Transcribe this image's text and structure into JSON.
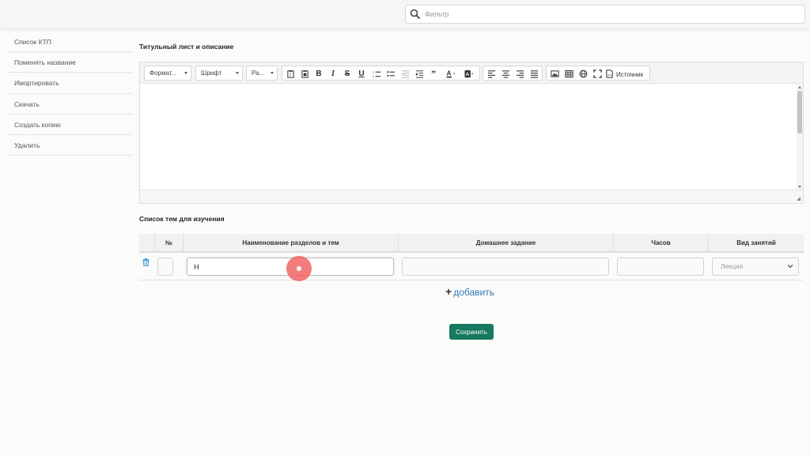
{
  "search": {
    "placeholder": "Фильтр"
  },
  "sidebar": {
    "items": [
      {
        "label": "Список КТП"
      },
      {
        "label": "Поменять название"
      },
      {
        "label": "Имортировать"
      },
      {
        "label": "Скачать"
      },
      {
        "label": "Создать копию"
      },
      {
        "label": "Удалить"
      }
    ]
  },
  "title_section": {
    "title": "Титульный лист и описание"
  },
  "editor": {
    "format_label": "Формат...",
    "font_label": "Шрифт",
    "size_label": "Ра...",
    "source_label": "Источник"
  },
  "topics_section": {
    "title": "Список тем для изучения"
  },
  "table": {
    "headers": {
      "num": "№",
      "name": "Наименование разделов и тем",
      "homework": "Домашнее задание",
      "hours": "Часов",
      "type": "Вид занятий"
    },
    "rows": [
      {
        "num": "",
        "name": "Н",
        "homework": "",
        "hours": "",
        "type": "Лекция"
      }
    ]
  },
  "add_label": "добавить",
  "save_label": "Сохранить",
  "colors": {
    "accent": "#17795e",
    "link": "#2f78b6",
    "cursor_marker": "#f06464"
  }
}
